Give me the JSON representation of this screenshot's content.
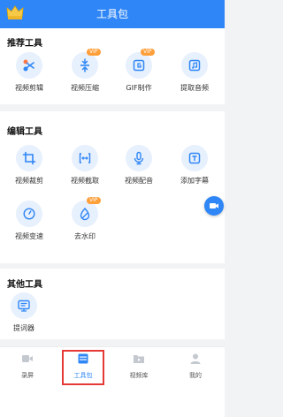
{
  "header": {
    "title": "工具包",
    "logo_icon": "crown-icon"
  },
  "sections": {
    "recommended": {
      "title": "推荐工具",
      "tools": [
        {
          "label": "视频剪辑",
          "icon": "scissors-icon",
          "vip": ""
        },
        {
          "label": "视频压缩",
          "icon": "compress-icon",
          "vip": "VIP"
        },
        {
          "label": "GIF制作",
          "icon": "gif-icon",
          "vip": "VIP"
        },
        {
          "label": "提取音频",
          "icon": "music-icon",
          "vip": ""
        }
      ]
    },
    "edit": {
      "title": "编辑工具",
      "tools": [
        {
          "label": "视频裁剪",
          "icon": "crop-icon",
          "vip": ""
        },
        {
          "label": "视频截取",
          "icon": "trim-icon",
          "vip": ""
        },
        {
          "label": "视频配音",
          "icon": "microphone-icon",
          "vip": ""
        },
        {
          "label": "添加字幕",
          "icon": "subtitle-icon",
          "vip": ""
        },
        {
          "label": "视频变速",
          "icon": "speed-icon",
          "vip": ""
        },
        {
          "label": "去水印",
          "icon": "watermark-remove-icon",
          "vip": "VIP"
        }
      ]
    },
    "other": {
      "title": "其他工具",
      "tools": [
        {
          "label": "提词器",
          "icon": "teleprompter-icon",
          "vip": ""
        }
      ]
    }
  },
  "tabbar": {
    "items": [
      {
        "label": "录屏",
        "icon": "record-icon"
      },
      {
        "label": "工具包",
        "icon": "toolbox-icon",
        "active": true
      },
      {
        "label": "视频库",
        "icon": "video-library-icon"
      },
      {
        "label": "我的",
        "icon": "profile-icon"
      }
    ]
  },
  "floating_button": {
    "icon": "record-video-icon"
  },
  "colors": {
    "primary": "#2f86f6",
    "vip": "#ff9f3a",
    "highlight": "#e53935",
    "icon_bg": "#e7f0fd"
  }
}
